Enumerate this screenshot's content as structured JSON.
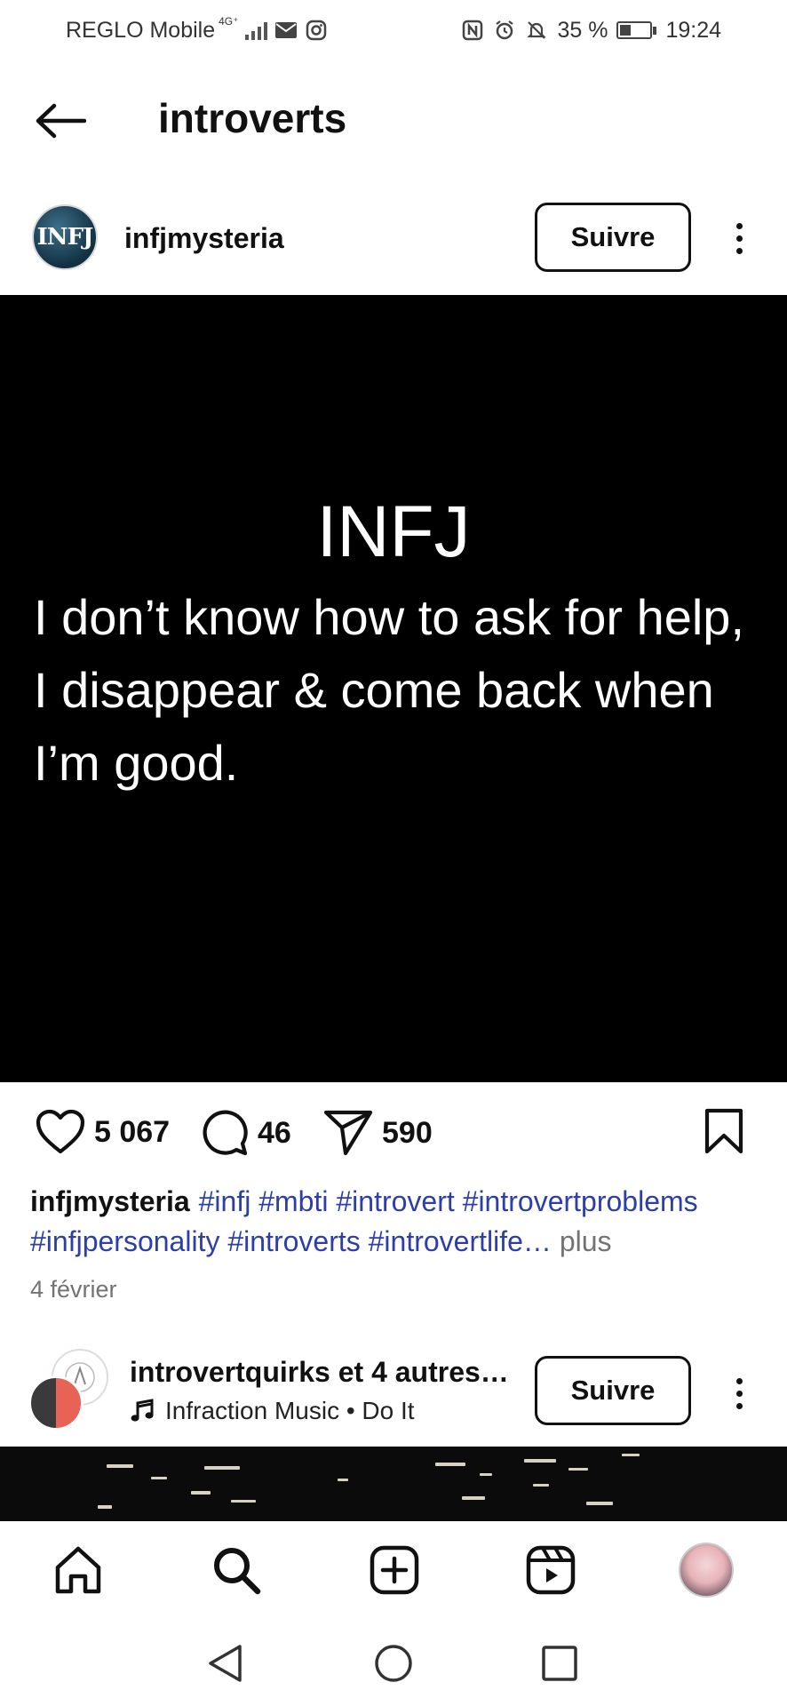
{
  "status_bar": {
    "carrier": "REGLO Mobile",
    "network": "4G⁺",
    "battery": "35 %",
    "time": "19:24"
  },
  "header": {
    "title": "introverts"
  },
  "post": {
    "username": "infjmysteria",
    "avatar_text": "INFJ",
    "follow_label": "Suivre",
    "image_title": "INFJ",
    "image_text": "I don’t know how to ask for help, I disappear & come back when I’m good.",
    "likes": "5 067",
    "comments": "46",
    "shares": "590",
    "caption_user": "infjmysteria",
    "hashtags_line1": "#infj #mbti #introvert #introvertproblems",
    "hashtags_line2": "#infjpersonality #introverts  #introvertlife…",
    "more_label": "plus",
    "date": "4 février"
  },
  "post2": {
    "username": "introvertquirks",
    "others": "et 4 autres…",
    "music": "Infraction Music • Do It",
    "follow_label": "Suivre"
  },
  "colors": {
    "hashtag": "#2d3ea8",
    "muted": "#737373"
  }
}
